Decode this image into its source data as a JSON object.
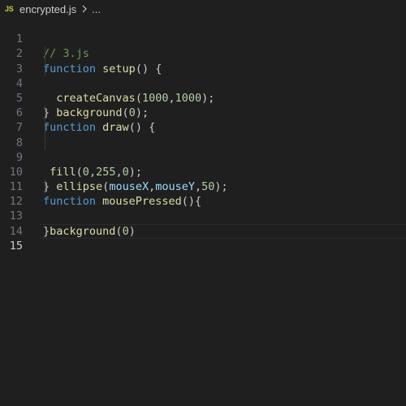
{
  "breadcrumb": {
    "file_icon": "JS",
    "file_name": "encrypted.js",
    "more": "..."
  },
  "lines": [
    {
      "number": "1"
    },
    {
      "number": "2"
    },
    {
      "number": "3"
    },
    {
      "number": "4"
    },
    {
      "number": "5"
    },
    {
      "number": "6"
    },
    {
      "number": "7"
    },
    {
      "number": "8"
    },
    {
      "number": "9"
    },
    {
      "number": "10"
    },
    {
      "number": "11"
    },
    {
      "number": "12"
    },
    {
      "number": "13"
    },
    {
      "number": "14"
    },
    {
      "number": "15"
    }
  ],
  "code": {
    "l1_comment": "// 3.js",
    "l2_kw": "function",
    "l2_name": "setup",
    "l2_rest": "() {",
    "l3_fn": "createCanvas",
    "l3_open": "(",
    "l3_a1": "1000",
    "l3_comma": ",",
    "l3_a2": "1000",
    "l3_close": ");",
    "l4_fn": "background",
    "l4_open": "(",
    "l4_a1": "0",
    "l4_close": ");",
    "l5": "}",
    "l6_kw": "function",
    "l6_name": "draw",
    "l6_rest": "() {",
    "l8_fn": "fill",
    "l8_open": "(",
    "l8_a1": "0",
    "l8_c1": ",",
    "l8_a2": "255",
    "l8_c2": ",",
    "l8_a3": "0",
    "l8_close": ");",
    "l9_fn": "ellipse",
    "l9_open": "(",
    "l9_v1": "mouseX",
    "l9_c1": ",",
    "l9_v2": "mouseY",
    "l9_c2": ",",
    "l9_a3": "50",
    "l9_close": ");",
    "l10": "}",
    "l11_kw": "function",
    "l11_name": "mousePressed",
    "l11_rest": "(){",
    "l12_fn": "background",
    "l12_open": "(",
    "l12_a1": "0",
    "l12_close": ")",
    "l13": "}"
  },
  "colors": {
    "background": "#1f1f1f",
    "keyword": "#569cd6",
    "function": "#dcdcaa",
    "number": "#b5cea8",
    "variable": "#9cdcfe",
    "comment": "#6a9955",
    "js_icon": "#cbcb41"
  },
  "icons": {
    "file_type": "javascript-file-icon",
    "separator": "chevron-right-icon"
  }
}
